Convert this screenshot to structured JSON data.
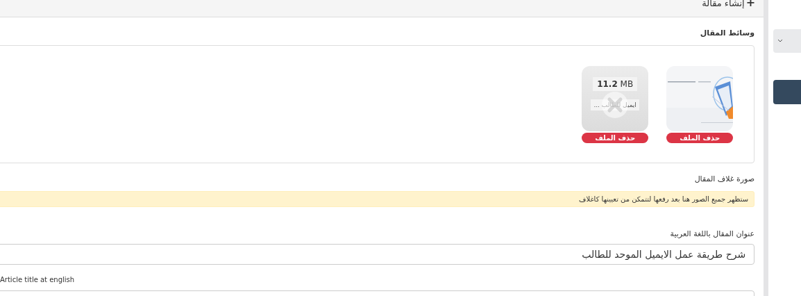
{
  "header": {
    "action_icon": "+",
    "action_label": "إنشاء مقالة"
  },
  "media": {
    "title": "وسائط المقال",
    "files": [
      {
        "kind": "picture",
        "delete_label": "حذف الملف"
      },
      {
        "kind": "document",
        "size": "11.2",
        "unit": "MB",
        "file_name": "ايميل للطالب ...",
        "delete_label": "حذف الملف"
      }
    ]
  },
  "cover": {
    "title": "صورة غلاف المقال",
    "notice": "ستظهر جميع الصور هنا بعد رفعها لتتمكن من تعيينها كاغلاف"
  },
  "title_ar": {
    "label": "عنوان المقال باللغة العربية",
    "value": "شرح طريقة عمل الايميل الموحد للطالب"
  },
  "title_en": {
    "label": "Article title at english"
  }
}
